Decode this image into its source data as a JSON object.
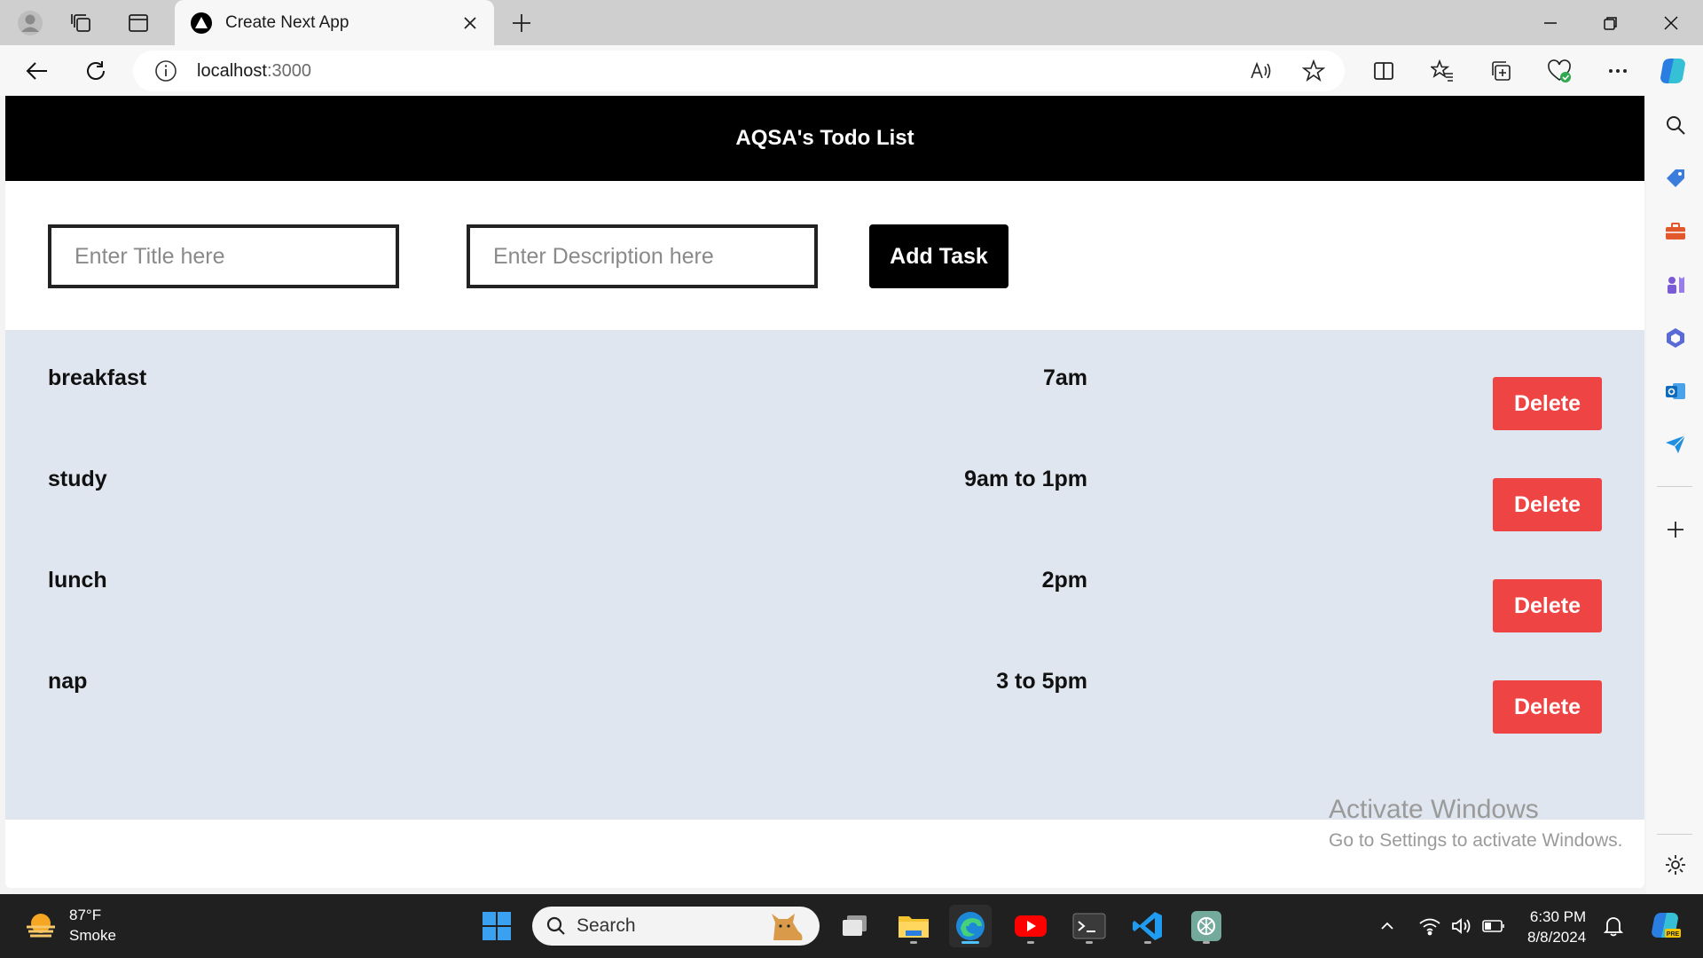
{
  "browser": {
    "tab_title": "Create Next App",
    "url_host": "localhost",
    "url_port": ":3000"
  },
  "app": {
    "title": "AQSA's Todo List",
    "title_placeholder": "Enter Title here",
    "description_placeholder": "Enter Description here",
    "add_label": "Add Task",
    "tasks": [
      {
        "title": "breakfast",
        "description": "7am",
        "delete_label": "Delete"
      },
      {
        "title": "study",
        "description": "9am to 1pm",
        "delete_label": "Delete"
      },
      {
        "title": "lunch",
        "description": "2pm",
        "delete_label": "Delete"
      },
      {
        "title": "nap",
        "description": "3 to 5pm",
        "delete_label": "Delete"
      }
    ]
  },
  "watermark": {
    "line1": "Activate Windows",
    "line2": "Go to Settings to activate Windows."
  },
  "taskbar": {
    "temperature": "87°F",
    "condition": "Smoke",
    "search_label": "Search",
    "time": "6:30 PM",
    "date": "8/8/2024"
  },
  "colors": {
    "header_bg": "#000000",
    "list_bg": "#e0e6ef",
    "delete_bg": "#ef4444",
    "accent": "#4cc2ff"
  }
}
